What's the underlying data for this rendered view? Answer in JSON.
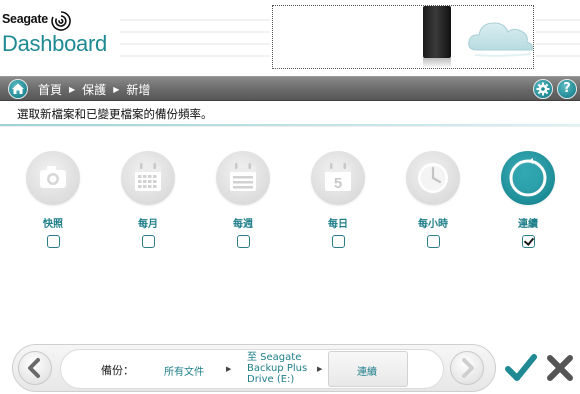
{
  "header": {
    "brand_name": "Seagate",
    "app_title": "Dashboard"
  },
  "nav": {
    "breadcrumb": [
      "首頁",
      "保護",
      "新增"
    ],
    "settings_icon": "gear-icon",
    "help_label": "?"
  },
  "subtitle": "選取新檔案和已變更檔案的備份頻率。",
  "options": [
    {
      "label": "快照",
      "icon": "camera-icon",
      "checked": false
    },
    {
      "label": "每月",
      "icon": "calendar-month-icon",
      "checked": false
    },
    {
      "label": "每週",
      "icon": "calendar-week-icon",
      "checked": false
    },
    {
      "label": "每日",
      "icon": "calendar-day-icon",
      "day_number": "5",
      "checked": false
    },
    {
      "label": "每小時",
      "icon": "clock-icon",
      "checked": false
    },
    {
      "label": "連續",
      "icon": "continuous-icon",
      "checked": true
    }
  ],
  "summary": {
    "label": "備份：",
    "files": "所有文件",
    "destination_line1": "至 Seagate",
    "destination_line2": "Backup Plus",
    "destination_line3": "Drive (E:)",
    "frequency": "連續"
  },
  "colors": {
    "accent": "#1f8a94",
    "nav_bar": "#6c6c6c"
  }
}
